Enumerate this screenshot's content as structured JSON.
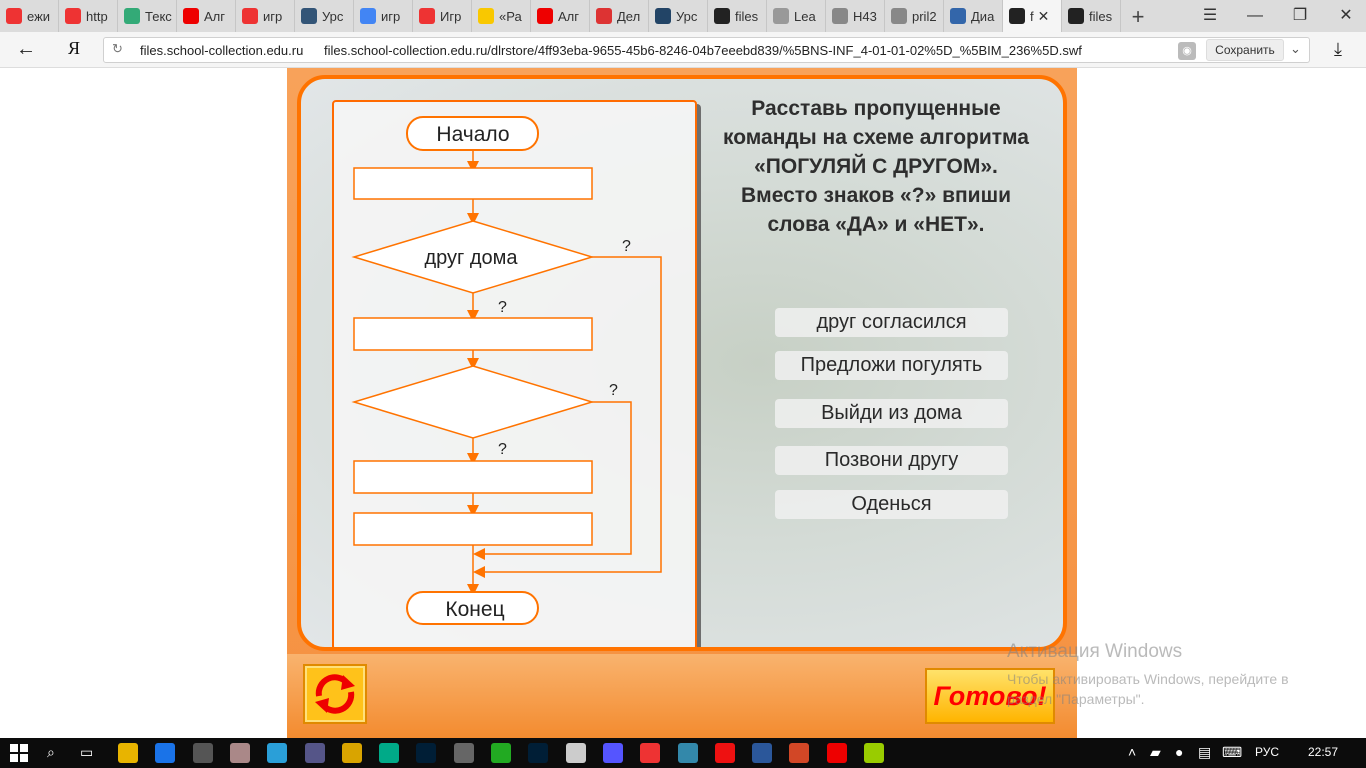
{
  "tabs": [
    {
      "label": "ежи",
      "color": "#e33"
    },
    {
      "label": "http",
      "color": "#e33"
    },
    {
      "label": "Текс",
      "color": "#3a7"
    },
    {
      "label": "Алг",
      "color": "#e00"
    },
    {
      "label": "игр",
      "color": "#e33"
    },
    {
      "label": "Урс",
      "color": "#357"
    },
    {
      "label": "игр",
      "color": "#4285f4"
    },
    {
      "label": "Игр",
      "color": "#e33"
    },
    {
      "label": "«Ра",
      "color": "#f9c800"
    },
    {
      "label": "Алг",
      "color": "#e00"
    },
    {
      "label": "Дел",
      "color": "#d33"
    },
    {
      "label": "Урс",
      "color": "#246"
    },
    {
      "label": "files",
      "color": "#222"
    },
    {
      "label": "Lea",
      "color": "#999"
    },
    {
      "label": "H43",
      "color": "#888"
    },
    {
      "label": "pril2",
      "color": "#888"
    },
    {
      "label": "Диа",
      "color": "#36a"
    },
    {
      "label": "f",
      "color": "#222",
      "active": true
    },
    {
      "label": "files",
      "color": "#222"
    }
  ],
  "window_controls": {
    "menu": "☰",
    "minimize": "—",
    "restore": "❐",
    "close": "✕"
  },
  "address": {
    "host": "files.school-collection.edu.ru",
    "url": "files.school-collection.edu.ru/dlrstore/4ff93eba-9655-45b6-8246-04b7eeebd839/%5BNS-INF_4-01-01-02%5D_%5BIM_236%5D.swf",
    "save_label": "Сохранить"
  },
  "flowchart": {
    "start": "Начало",
    "end": "Конец",
    "condition1": "друг дома",
    "q_marks": [
      "?",
      "?",
      "?",
      "?"
    ]
  },
  "task": {
    "lines": [
      "Расставь пропущенные",
      "команды на схеме алгоритма",
      "«ПОГУЛЯЙ С ДРУГОМ».",
      "Вместо знаков «?» впиши",
      "слова «ДА» и «НЕТ»."
    ]
  },
  "options": [
    "друг согласился",
    "Предложи погулять",
    "Выйди из дома",
    "Позвони другу",
    "Оденься"
  ],
  "buttons": {
    "done": "Готово!"
  },
  "watermark": {
    "title": "Активация Windows",
    "line1": "Чтобы активировать Windows, перейдите в",
    "line2": "раздел \"Параметры\"."
  },
  "taskbar": {
    "apps": [
      {
        "name": "explorer",
        "color": "#e8b400"
      },
      {
        "name": "edge",
        "color": "#1a73e8"
      },
      {
        "name": "store",
        "color": "#555"
      },
      {
        "name": "app4",
        "color": "#a88"
      },
      {
        "name": "app5",
        "color": "#2a9fd8"
      },
      {
        "name": "app6",
        "color": "#558"
      },
      {
        "name": "app7",
        "color": "#d9a400"
      },
      {
        "name": "app8",
        "color": "#0a8"
      },
      {
        "name": "photoshop1",
        "color": "#001e36"
      },
      {
        "name": "app10",
        "color": "#666"
      },
      {
        "name": "app11",
        "color": "#2a2"
      },
      {
        "name": "photoshop2",
        "color": "#001e36"
      },
      {
        "name": "app13",
        "color": "#ccc"
      },
      {
        "name": "app14",
        "color": "#55f"
      },
      {
        "name": "yandex-browser",
        "color": "#e33"
      },
      {
        "name": "app16",
        "color": "#38a"
      },
      {
        "name": "opera",
        "color": "#e11"
      },
      {
        "name": "word",
        "color": "#2b579a"
      },
      {
        "name": "powerpoint",
        "color": "#d24726"
      },
      {
        "name": "acrobat",
        "color": "#e00"
      },
      {
        "name": "app21",
        "color": "#9c0"
      }
    ],
    "lang": "РУС",
    "time": "22:57"
  }
}
